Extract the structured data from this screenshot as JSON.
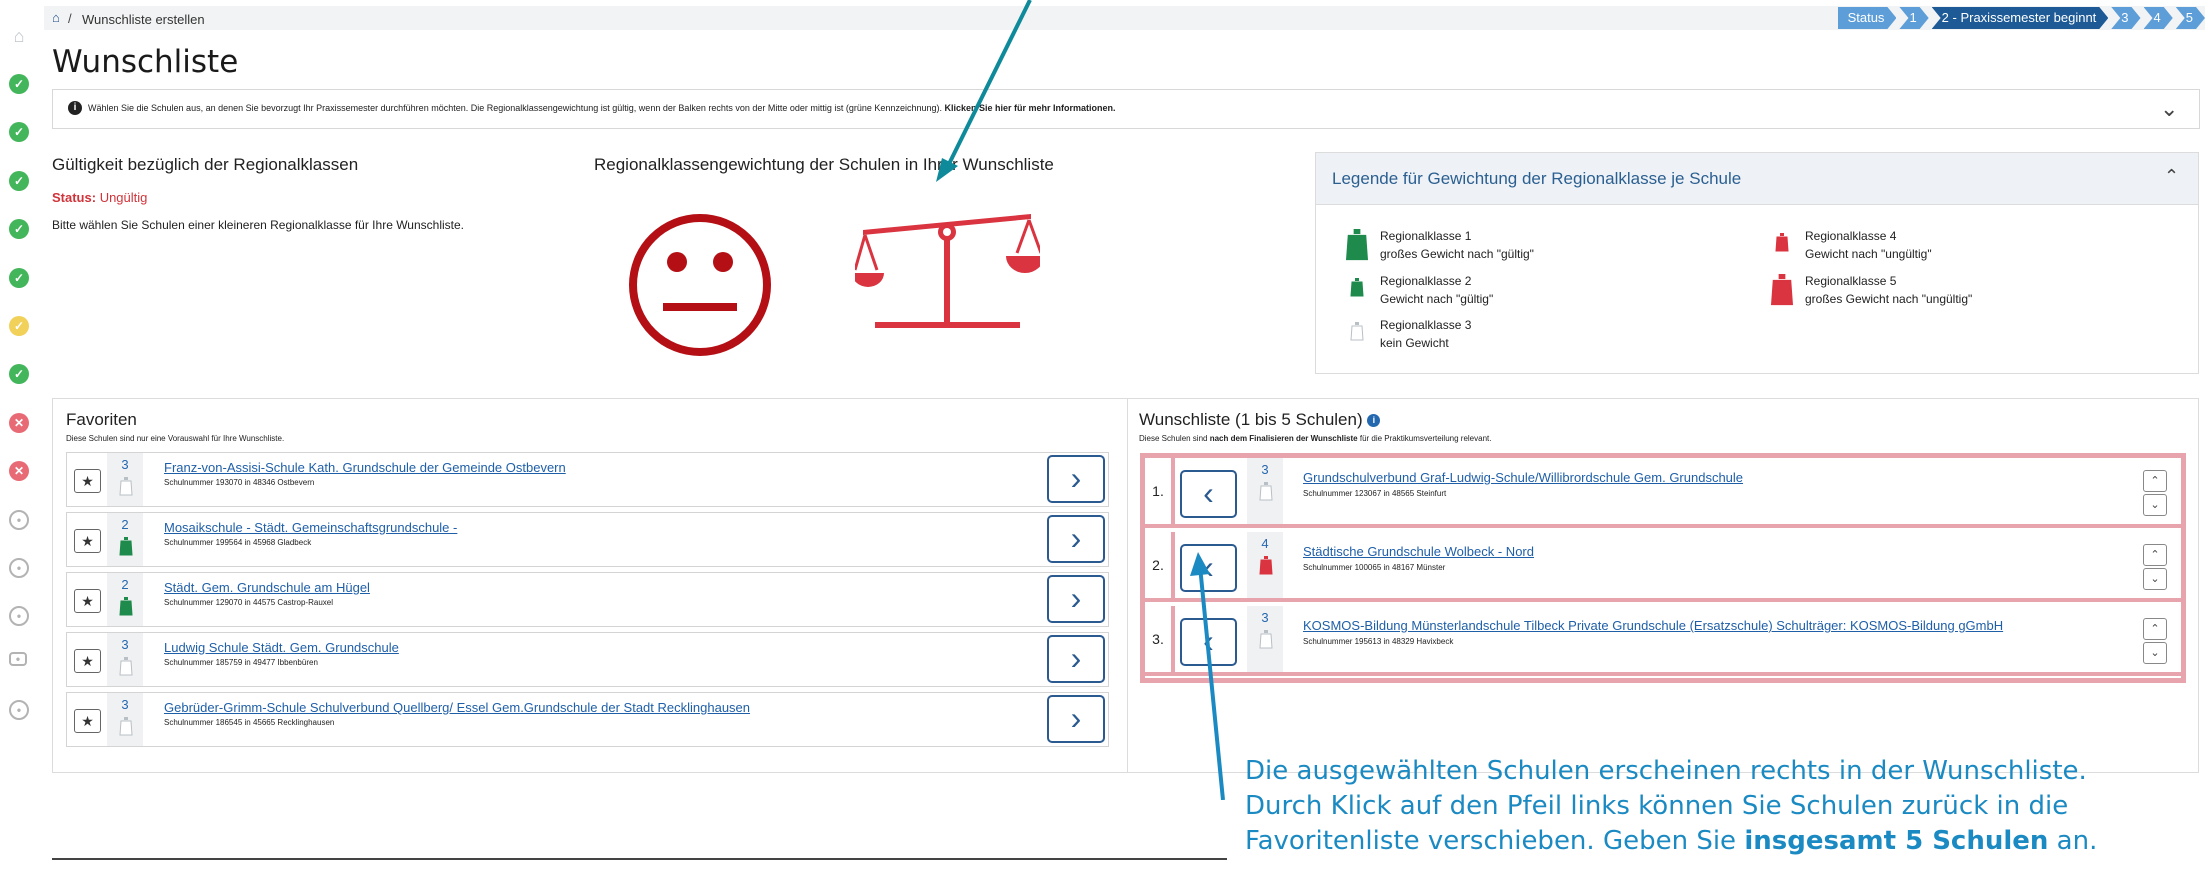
{
  "breadcrumb": {
    "home_icon": "home-icon",
    "separator": "/",
    "current": "Wunschliste erstellen"
  },
  "steps": [
    "Status",
    "1",
    "2 - Praxissemester beginnt",
    "3",
    "4",
    "5"
  ],
  "steps_active_index": 2,
  "page_title": "Wunschliste",
  "info": {
    "text": "Wählen Sie die Schulen aus, an denen Sie bevorzugt Ihr Praxissemester durchführen möchten. Die Regionalklassengewichtung ist gültig, wenn der Balken rechts von der Mitte oder mittig ist (grüne Kennzeichnung). ",
    "link": "Klicken Sie hier für mehr Informationen."
  },
  "validity": {
    "heading": "Gültigkeit bezüglich der Regionalklassen",
    "status_label": "Status:",
    "status_value": "Ungültig",
    "note": "Bitte wählen Sie Schulen einer kleineren Regionalklasse für Ihre Wunschliste."
  },
  "weighting_heading": "Regionalklassengewichtung der Schulen in Ihrer Wunschliste",
  "legend": {
    "title": "Legende für Gewichtung der Regionalklasse je Schule",
    "items": [
      {
        "name": "Regionalklasse 1",
        "desc": "großes Gewicht nach \"gültig\"",
        "color": "#1e8a4c"
      },
      {
        "name": "Regionalklasse 2",
        "desc": "Gewicht nach \"gültig\"",
        "color": "#1e8a4c"
      },
      {
        "name": "Regionalklasse 3",
        "desc": "kein Gewicht",
        "color": "#ffffff"
      },
      {
        "name": "Regionalklasse 4",
        "desc": "Gewicht nach \"ungültig\"",
        "color": "#d9343f"
      },
      {
        "name": "Regionalklasse 5",
        "desc": "großes Gewicht nach \"ungültig\"",
        "color": "#d9343f"
      }
    ]
  },
  "favorites": {
    "title": "Favoriten",
    "subtitle": "Diese Schulen sind nur eine Vorauswahl für Ihre Wunschliste.",
    "rows": [
      {
        "rk": "3",
        "name": "Franz-von-Assisi-Schule Kath. Grundschule der Gemeinde Ostbevern",
        "num": "Schulnummer 193070 in 48346 Ostbevern"
      },
      {
        "rk": "2",
        "name": "Mosaikschule - Städt. Gemeinschaftsgrundschule -",
        "num": "Schulnummer 199564 in 45968 Gladbeck"
      },
      {
        "rk": "2",
        "name": "Städt. Gem. Grundschule am Hügel",
        "num": "Schulnummer 129070 in 44575 Castrop-Rauxel"
      },
      {
        "rk": "3",
        "name": "Ludwig Schule Städt. Gem. Grundschule",
        "num": "Schulnummer 185759 in 49477 Ibbenbüren"
      },
      {
        "rk": "3",
        "name": "Gebrüder-Grimm-Schule Schulverbund Quellberg/ Essel Gem.Grundschule der Stadt Recklinghausen",
        "num": "Schulnummer 186545 in 45665 Recklinghausen"
      }
    ]
  },
  "wishlist": {
    "title": "Wunschliste (1 bis 5 Schulen)",
    "subtitle_pre": "Diese Schulen sind ",
    "subtitle_bold": "nach dem Finalisieren der Wunschliste",
    "subtitle_post": " für die Praktikumsverteilung relevant.",
    "rows": [
      {
        "pos": "1.",
        "rk": "3",
        "name": "Grundschulverbund Graf-Ludwig-Schule/Willibrordschule Gem. Grundschule",
        "num": "Schulnummer 123067 in 48565 Steinfurt"
      },
      {
        "pos": "2.",
        "rk": "4",
        "name": "Städtische Grundschule Wolbeck - Nord",
        "num": "Schulnummer 100065 in 48167 Münster"
      },
      {
        "pos": "3.",
        "rk": "3",
        "name": "KOSMOS-Bildung Münsterlandschule Tilbeck Private Grundschule (Ersatzschule) Schulträger: KOSMOS-Bildung gGmbH",
        "num": "Schulnummer 195613 in 48329 Havixbeck"
      }
    ]
  },
  "callout": {
    "line1": "Die ausgewählten Schulen erscheinen rechts in der Wunschliste.",
    "line2": "Durch Klick auf den Pfeil links können Sie Schulen zurück in die",
    "line3_pre": "Favoritenliste verschieben. Geben Sie ",
    "line3_bold": "insgesamt 5 Schulen",
    "line3_post": " an."
  },
  "colors": {
    "accent": "#1d5a96",
    "valid": "#1e8a4c",
    "invalid": "#d9343f",
    "callout": "#1b8ac2"
  }
}
